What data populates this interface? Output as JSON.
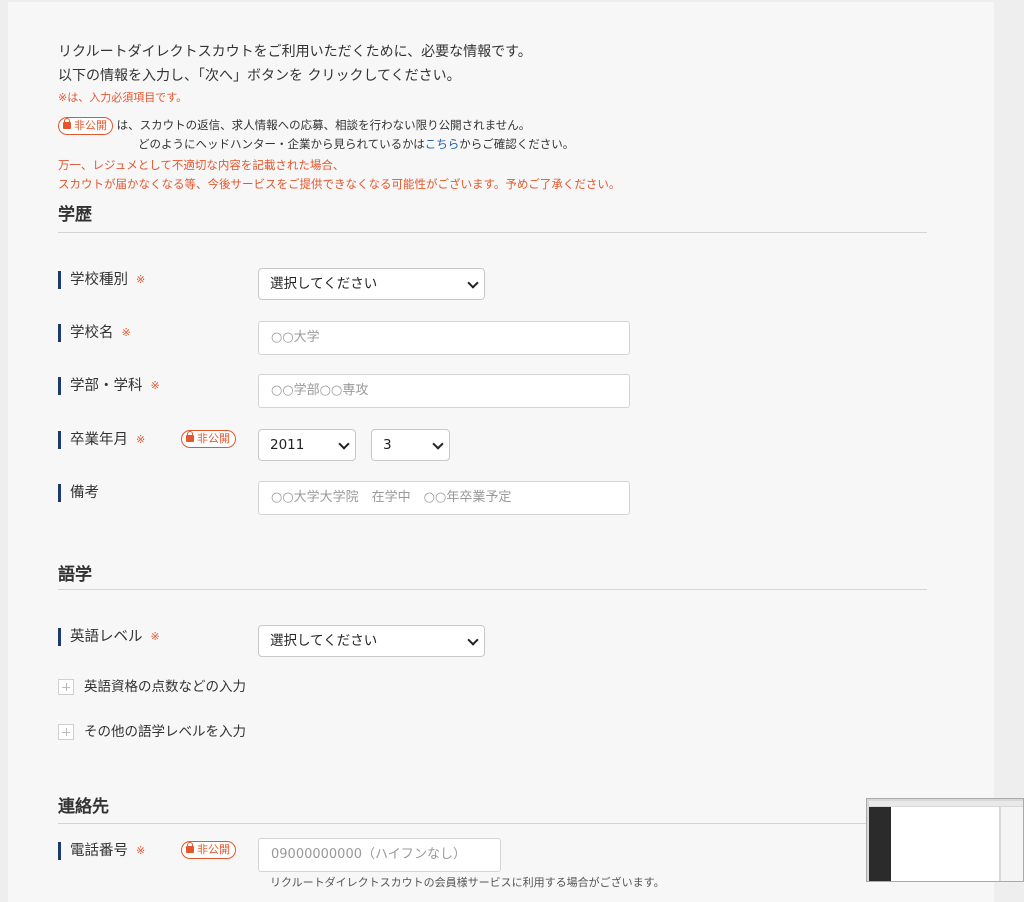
{
  "intro": {
    "line1": "リクルートダイレクトスカウトをご利用いただくために、必要な情報です。",
    "line2": "以下の情報を入力し、「次へ」ボタンを クリックしてください。",
    "required_note": "※は、入力必須項目です。"
  },
  "notice": {
    "badge": "非公開",
    "text1": " は、スカウトの返信、求人情報への応募、相談を行わない限り公開されません。",
    "text2_pre": "どのようにヘッドハンター・企業から見られているかは",
    "text2_link": "こちら",
    "text2_post": "からご確認ください。",
    "warn1": "万一、レジュメとして不適切な内容を記載された場合、",
    "warn2": "スカウトが届かなくなる等、今後サービスをご提供できなくなる可能性がございます。予めご了承ください。"
  },
  "education": {
    "title": "学歴",
    "school_type": {
      "label": "学校種別",
      "star": "※",
      "value": "選択してください"
    },
    "school_name": {
      "label": "学校名",
      "star": "※",
      "placeholder": "○○大学"
    },
    "faculty": {
      "label": "学部・学科",
      "star": "※",
      "placeholder": "○○学部○○専攻"
    },
    "graduation": {
      "label": "卒業年月",
      "star": "※",
      "badge": "非公開",
      "year": "2011",
      "month": "3"
    },
    "remarks": {
      "label": "備考",
      "placeholder": "○○大学大学院　在学中　○○年卒業予定"
    }
  },
  "language": {
    "title": "語学",
    "english_level": {
      "label": "英語レベル",
      "star": "※",
      "value": "選択してください"
    },
    "expand_english": "英語資格の点数などの入力",
    "expand_other": "その他の語学レベルを入力"
  },
  "contact": {
    "title": "連絡先",
    "phone": {
      "label": "電話番号",
      "star": "※",
      "badge": "非公開",
      "placeholder": "09000000000（ハイフンなし）"
    },
    "phone_note": "リクルートダイレクトスカウトの会員様サービスに利用する場合がございます。"
  },
  "colors": {
    "accent": "#e4572e",
    "label_bar": "#1e3a6d",
    "link": "#1f5fa8"
  }
}
